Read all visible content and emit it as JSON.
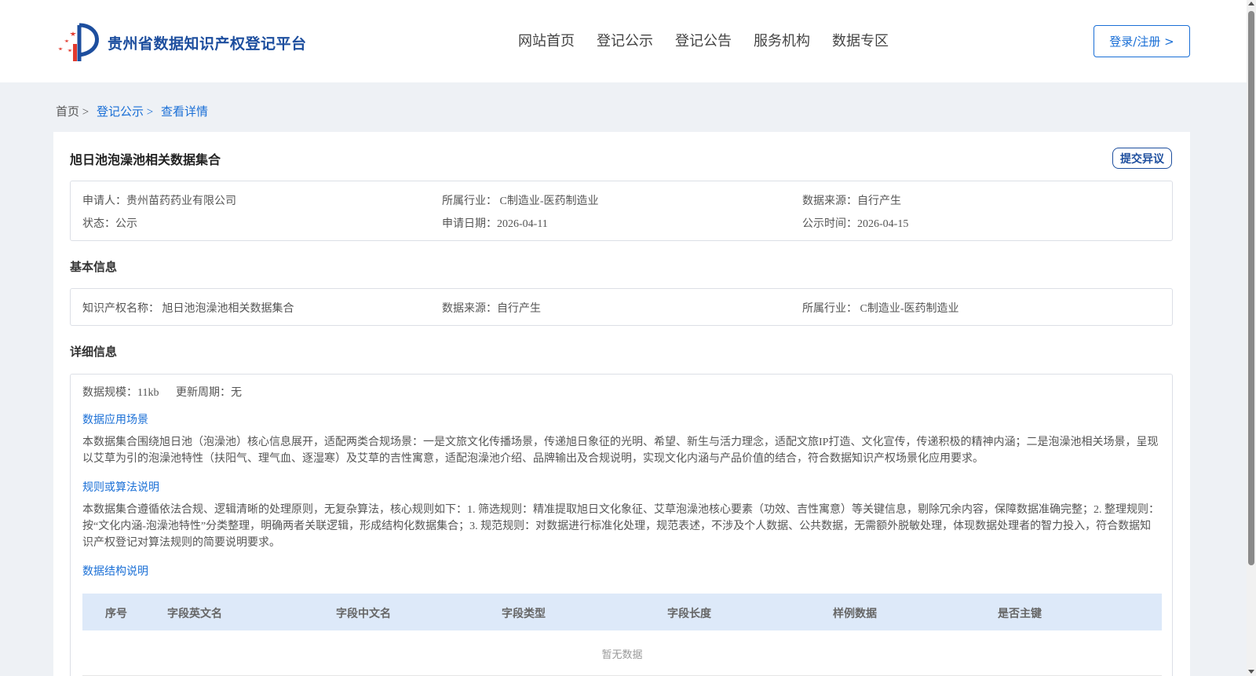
{
  "header": {
    "logo_text": "贵州省数据知识产权登记平台",
    "nav": [
      "网站首页",
      "登记公示",
      "登记公告",
      "服务机构",
      "数据专区"
    ],
    "login_label": "登录/注册 >"
  },
  "breadcrumb": {
    "home": "首页 >",
    "list": "登记公示 >",
    "current": "查看详情"
  },
  "record": {
    "title": "旭日池泡澡池相关数据集合",
    "objection_label": "提交异议",
    "applicant": "申请人：贵州苗药药业有限公司",
    "industry": "所属行业： C制造业-医药制造业",
    "source": "数据来源：自行产生",
    "status": "状态：公示",
    "apply_date": "申请日期：2026-04-11",
    "publish_date": "公示时间：2026-04-15"
  },
  "basic": {
    "section_title": "基本信息",
    "ip_name": "知识产权名称： 旭日池泡澡池相关数据集合",
    "source": "数据来源：自行产生",
    "industry": "所属行业： C制造业-医药制造业"
  },
  "detail": {
    "section_title": "详细信息",
    "scale": "数据规模：11kb",
    "update_cycle": "更新周期：无",
    "scene_title": "数据应用场景",
    "scene_text": "本数据集合围绕旭日池（泡澡池）核心信息展开，适配两类合规场景：一是文旅文化传播场景，传递旭日象征的光明、希望、新生与活力理念，适配文旅IP打造、文化宣传，传递积极的精神内涵；二是泡澡池相关场景，呈现以艾草为引的泡澡池特性（扶阳气、理气血、逐湿寒）及艾草的吉性寓意，适配泡澡池介绍、品牌输出及合规说明，实现文化内涵与产品价值的结合，符合数据知识产权场景化应用要求。",
    "rule_title": "规则或算法说明",
    "rule_text": "本数据集合遵循依法合规、逻辑清晰的处理原则，无复杂算法，核心规则如下：1. 筛选规则：精准提取旭日文化象征、艾草泡澡池核心要素（功效、吉性寓意）等关键信息，剔除冗余内容，保障数据准确完整；2. 整理规则：按“文化内涵-泡澡池特性”分类整理，明确两者关联逻辑，形成结构化数据集合；3. 规范规则：对数据进行标准化处理，规范表述，不涉及个人数据、公共数据，无需额外脱敏处理，体现数据处理者的智力投入，符合数据知识产权登记对算法规则的简要说明要求。",
    "structure_title": "数据结构说明",
    "columns": [
      "序号",
      "字段英文名",
      "字段中文名",
      "字段类型",
      "字段长度",
      "样例数据",
      "是否主键"
    ],
    "empty_text": "暂无数据"
  },
  "colors": {
    "brand": "#1d4e9e",
    "link": "#1a6fd6",
    "table_header": "#dde9f9",
    "logo_red": "#e23a2e"
  }
}
